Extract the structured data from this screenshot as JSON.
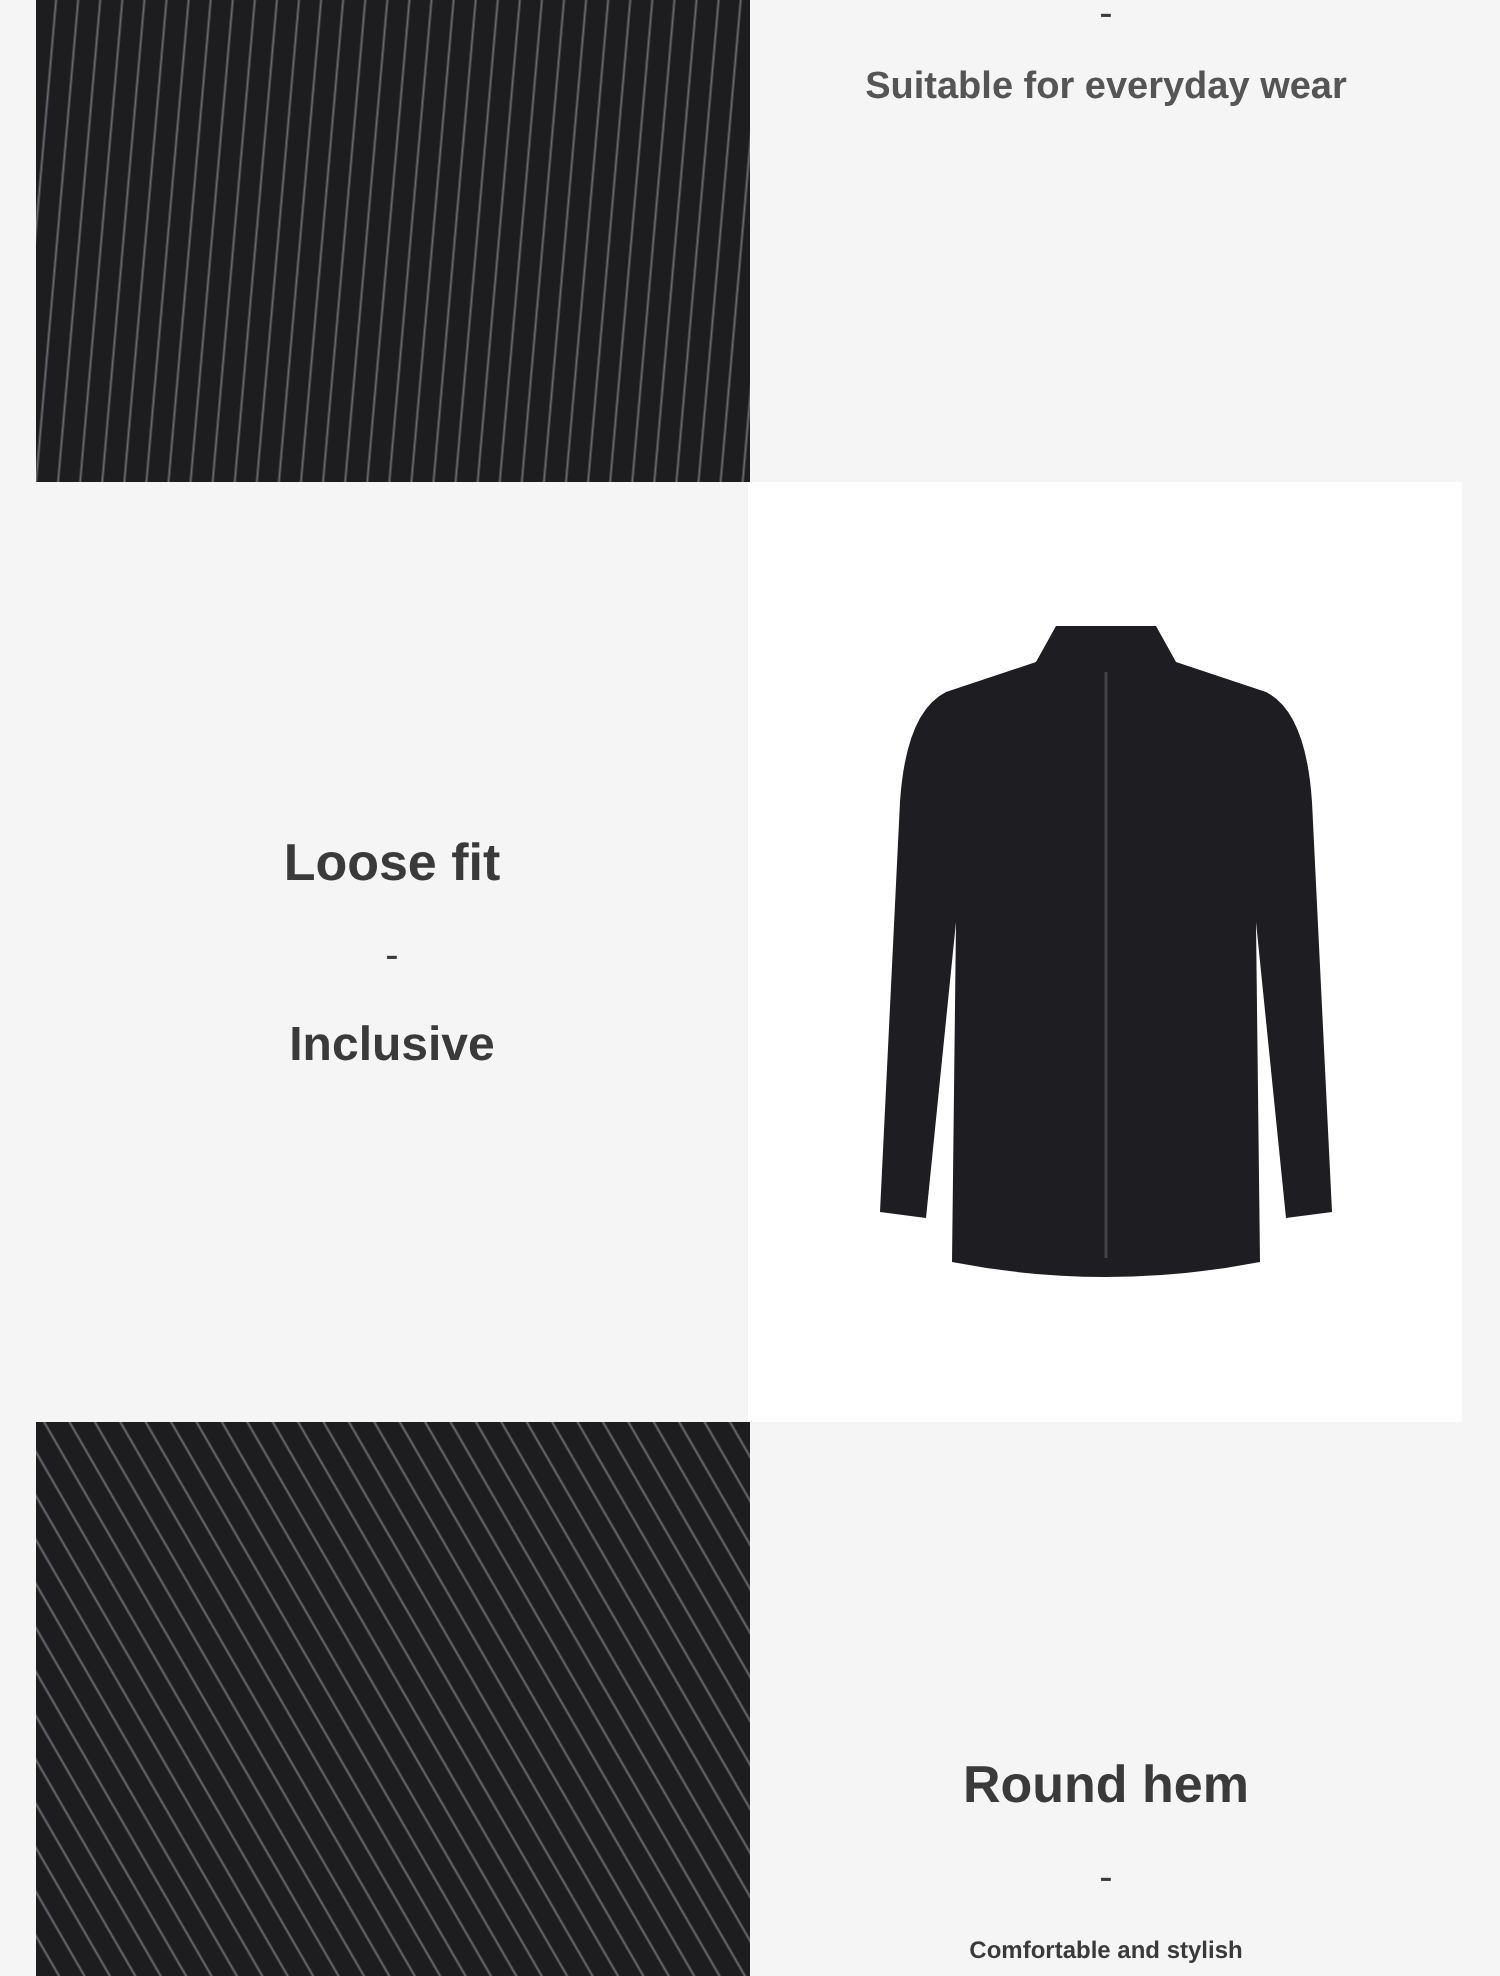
{
  "sections": [
    {
      "kind": "photo-left",
      "lines": [
        "-",
        "Suitable for everyday wear"
      ]
    },
    {
      "kind": "product-right",
      "lines": [
        "Loose fit",
        "-",
        "Inclusive"
      ]
    },
    {
      "kind": "photo-left",
      "lines": [
        "Round hem",
        "-",
        "Comfortable and stylish"
      ]
    }
  ]
}
